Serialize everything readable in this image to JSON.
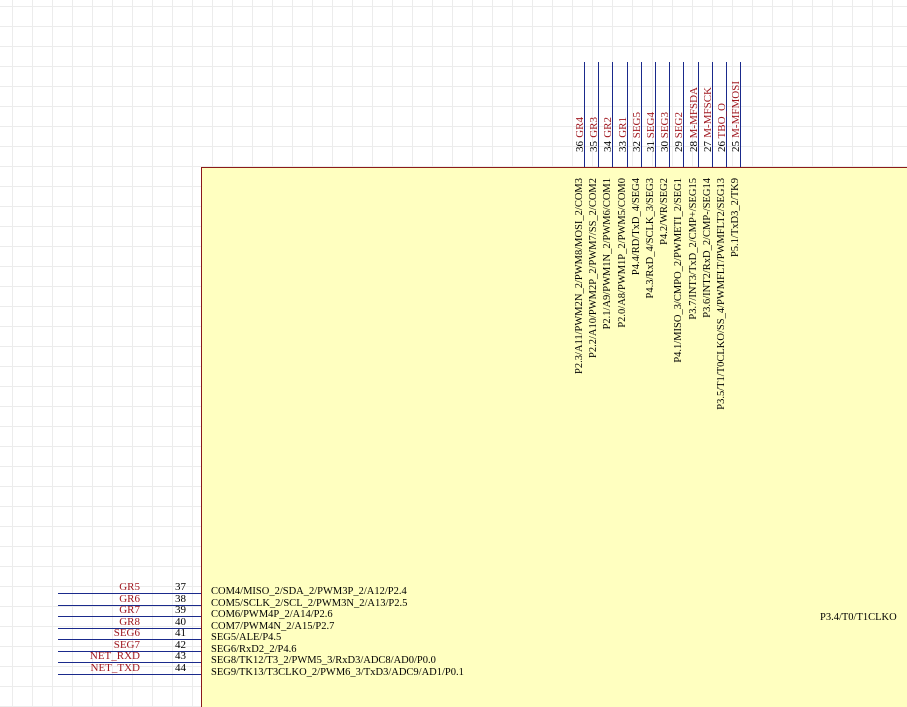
{
  "top_pins": [
    {
      "num": "36",
      "net": "GR4",
      "func": "P2.3/A11/PWM2N_2/PWM8/MOSI_2/COM3"
    },
    {
      "num": "35",
      "net": "GR3",
      "func": "P2.2/A10/PWM2P_2/PWM7/SS_2/COM2"
    },
    {
      "num": "34",
      "net": "GR2",
      "func": "P2.1/A9/PWM1N_2/PWM6/COM1"
    },
    {
      "num": "33",
      "net": "GR1",
      "func": "P2.0/A8/PWM1P_2/PWM5/COM0"
    },
    {
      "num": "32",
      "net": "SEG5",
      "func": "P4.4/RD/TxD_4/SEG4"
    },
    {
      "num": "31",
      "net": "SEG4",
      "func": "P4.3/RxD_4/SCLK_3/SEG3"
    },
    {
      "num": "30",
      "net": "SEG3",
      "func": "P4.2/WR/SEG2"
    },
    {
      "num": "29",
      "net": "SEG2",
      "func": "P4.1/MISO_3/CMPO_2/PWMETI_2/SEG1"
    },
    {
      "num": "28",
      "net": "M-MFSDA",
      "func": "P3.7/INT3/TxD_2/CMP+/SEG15"
    },
    {
      "num": "27",
      "net": "M-MFSCK",
      "func": "P3.6/INT2/RxD_2/CMP-/SEG14"
    },
    {
      "num": "26",
      "net": "TBO_O",
      "func": "P3.5/T1/T0CLKO/SS_4/PWMFLT/PWMFLT2/SEG13"
    },
    {
      "num": "25",
      "net": "M-MFMOSI",
      "func": "P5.1/TxD3_2/TK9"
    }
  ],
  "left_pins": [
    {
      "num": "37",
      "net": "GR5",
      "func": "COM4/MISO_2/SDA_2/PWM3P_2/A12/P2.4"
    },
    {
      "num": "38",
      "net": "GR6",
      "func": "COM5/SCLK_2/SCL_2/PWM3N_2/A13/P2.5"
    },
    {
      "num": "39",
      "net": "GR7",
      "func": "COM6/PWM4P_2/A14/P2.6"
    },
    {
      "num": "40",
      "net": "GR8",
      "func": "COM7/PWM4N_2/A15/P2.7"
    },
    {
      "num": "41",
      "net": "SEG6",
      "func": "SEG5/ALE/P4.5"
    },
    {
      "num": "42",
      "net": "SEG7",
      "func": "SEG6/RxD2_2/P4.6"
    },
    {
      "num": "43",
      "net": "NET_RXD",
      "func": "SEG8/TK12/T3_2/PWM5_3/RxD3/ADC8/AD0/P0.0"
    },
    {
      "num": "44",
      "net": "NET_TXD",
      "func": "SEG9/TK13/T3CLKO_2/PWM6_3/TxD3/ADC9/AD1/P0.1"
    }
  ],
  "right_func": "P3.4/T0/T1CLKO"
}
